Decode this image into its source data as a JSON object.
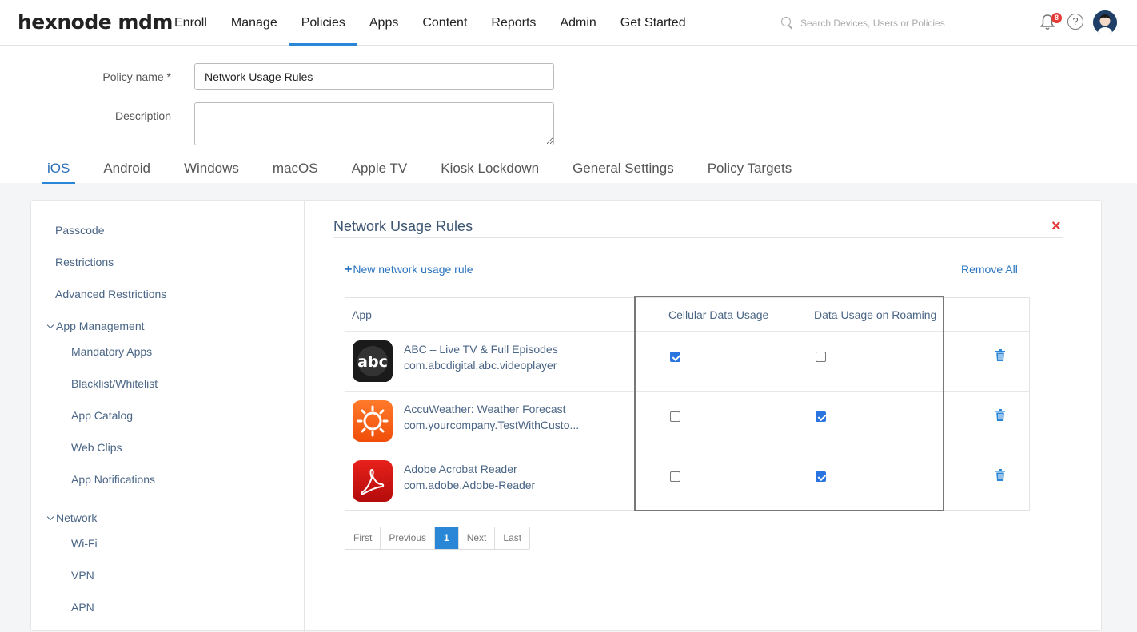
{
  "header": {
    "logo": "hexnode mdm",
    "nav": [
      "Enroll",
      "Manage",
      "Policies",
      "Apps",
      "Content",
      "Reports",
      "Admin",
      "Get Started"
    ],
    "active_nav": "Policies",
    "search_placeholder": "Search Devices, Users or Policies",
    "notification_count": "8",
    "help_label": "?"
  },
  "form": {
    "policy_name_label": "Policy name *",
    "policy_name_value": "Network Usage Rules",
    "description_label": "Description",
    "description_value": ""
  },
  "platform_tabs": [
    "iOS",
    "Android",
    "Windows",
    "macOS",
    "Apple TV",
    "Kiosk Lockdown",
    "General Settings",
    "Policy Targets"
  ],
  "sidebar": {
    "passcode": "Passcode",
    "restrictions": "Restrictions",
    "advanced_restrictions": "Advanced Restrictions",
    "app_management": "App Management",
    "app_management_items": [
      "Mandatory Apps",
      "Blacklist/Whitelist",
      "App Catalog",
      "Web Clips",
      "App Notifications"
    ],
    "network": "Network",
    "network_items": [
      "Wi-Fi",
      "VPN",
      "APN"
    ]
  },
  "main": {
    "title": "Network Usage Rules",
    "close": "×",
    "new_rule": "New network usage rule",
    "new_rule_plus": "+",
    "remove_all": "Remove All",
    "columns": {
      "app": "App",
      "cellular": "Cellular Data Usage",
      "roaming": "Data Usage on Roaming"
    },
    "rows": [
      {
        "name": "ABC – Live TV & Full Episodes",
        "id": "com.abcdigital.abc.videoplayer",
        "icon": "abc-app-icon",
        "icon_text": "abc",
        "cellular": true,
        "roaming": false
      },
      {
        "name": "AccuWeather: Weather Forecast",
        "id": "com.yourcompany.TestWithCusto...",
        "icon": "accuweather-app-icon",
        "cellular": false,
        "roaming": true
      },
      {
        "name": "Adobe Acrobat Reader",
        "id": "com.adobe.Adobe-Reader",
        "icon": "adobe-acrobat-app-icon",
        "cellular": false,
        "roaming": true
      }
    ]
  },
  "pagination": {
    "first": "First",
    "previous": "Previous",
    "current": "1",
    "next": "Next",
    "last": "Last"
  },
  "colors": {
    "accent": "#2a86d6",
    "link": "#2a74c0",
    "danger": "#e53935"
  }
}
